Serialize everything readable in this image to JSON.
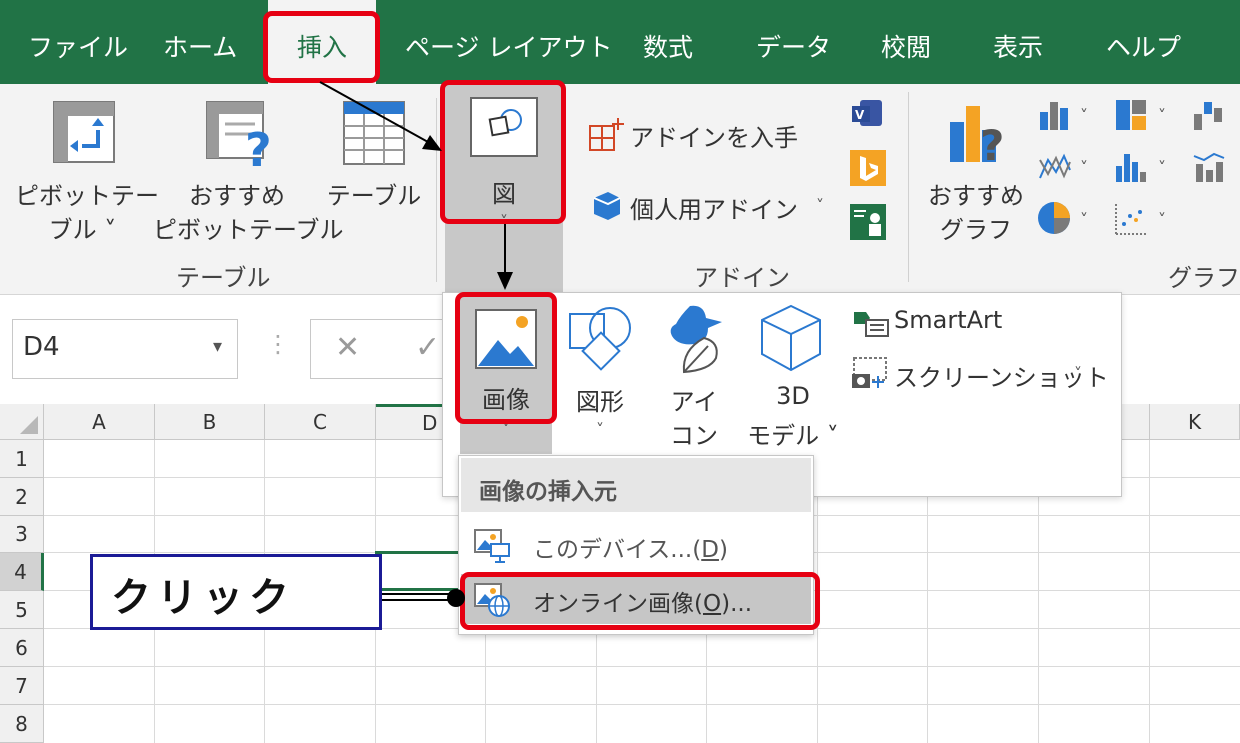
{
  "menu": {
    "tabs": [
      {
        "label": "ファイル"
      },
      {
        "label": "ホーム"
      },
      {
        "label": "挿入"
      },
      {
        "label": "ページ レイアウト"
      },
      {
        "label": "数式"
      },
      {
        "label": "データ"
      },
      {
        "label": "校閲"
      },
      {
        "label": "表示"
      },
      {
        "label": "ヘルプ"
      }
    ],
    "active_tab": "挿入"
  },
  "ribbon": {
    "pivot_table": {
      "line1": "ピボットテー",
      "line2": "ブル ˅"
    },
    "recommended_pivot": {
      "line1": "おすすめ",
      "line2": "ピボットテーブル"
    },
    "table": {
      "label": "テーブル"
    },
    "group_table": "テーブル",
    "illustrations": {
      "label": "図",
      "chevron": "˅"
    },
    "get_addins": {
      "label": "アドインを入手"
    },
    "my_addins": {
      "label": "個人用アドイン",
      "chevron": "˅"
    },
    "group_addins": "アドイン",
    "recommended_charts": {
      "line1": "おすすめ",
      "line2": "グラフ"
    },
    "group_charts": "グラフ",
    "chevron": "˅"
  },
  "formula_bar": {
    "name_box": "D4",
    "name_box_arrow": "▾",
    "dots": "⋮",
    "cancel": "✕",
    "confirm": "✓"
  },
  "grid": {
    "columns": [
      "A",
      "B",
      "C",
      "D",
      "K"
    ],
    "rows": [
      "1",
      "2",
      "3",
      "4",
      "5",
      "6",
      "7",
      "8"
    ],
    "selected_cell": "D4"
  },
  "illustrations_panel": {
    "pictures": {
      "label": "画像",
      "chevron": "˅"
    },
    "shapes": {
      "label": "図形",
      "chevron": "˅"
    },
    "icons": {
      "line1": "アイ",
      "line2": "コン"
    },
    "models3d": {
      "line1": "3D",
      "line2": "モデル ˅"
    },
    "smartart": {
      "label": "SmartArt"
    },
    "screenshot": {
      "label": "スクリーンショット",
      "chevron": "˅"
    }
  },
  "insert_from_menu": {
    "header": "画像の挿入元",
    "items": [
      {
        "label": "このデバイス...",
        "shortcut_open": "(",
        "shortcut": "D",
        "shortcut_close": ")"
      },
      {
        "label": "オンライン画像",
        "shortcut_open": "(",
        "shortcut": "O",
        "shortcut_close": ")..."
      }
    ]
  },
  "annotation": {
    "callout_text": "クリック",
    "highlight_color": "#e60012",
    "callout_border": "#1b1b96"
  },
  "colors": {
    "excel_green": "#217346",
    "ribbon_bg": "#f3f3f3",
    "selected_bg": "#c8c8c8"
  }
}
